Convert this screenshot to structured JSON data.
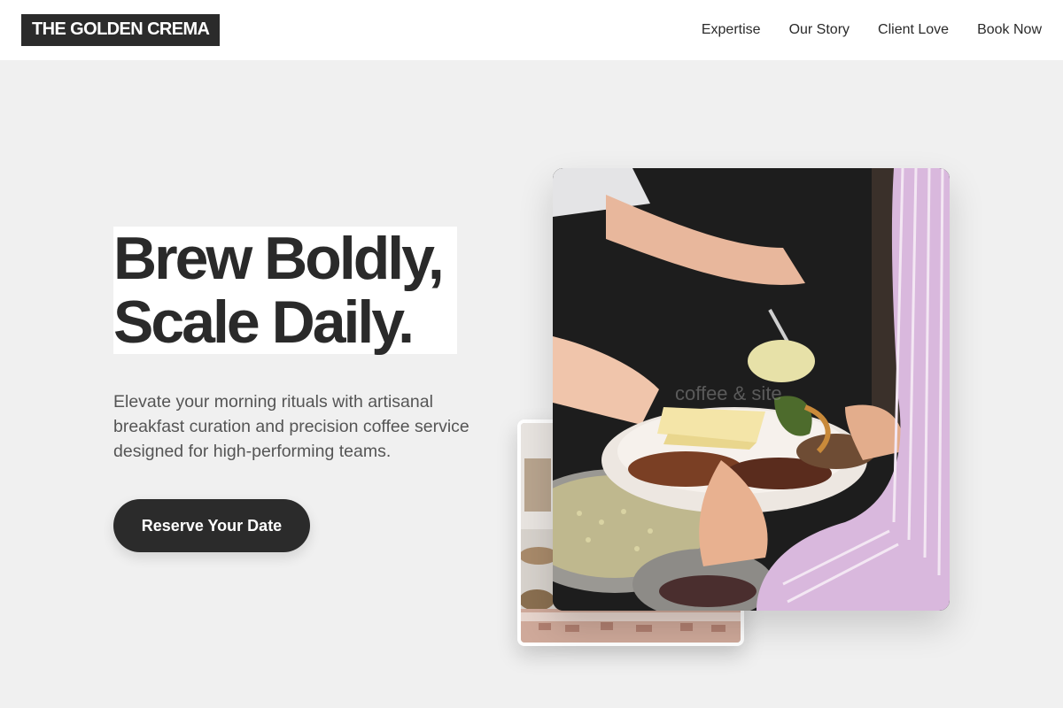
{
  "brand": {
    "logo_text": "THE GOLDEN CREMA"
  },
  "nav": {
    "items": [
      {
        "label": "Expertise"
      },
      {
        "label": "Our Story"
      },
      {
        "label": "Client Love"
      },
      {
        "label": "Book Now"
      }
    ]
  },
  "hero": {
    "title_line1": "Brew Boldly,",
    "title_line2": "Scale Daily.",
    "description": "Elevate your morning rituals with artisanal breakfast curation and precision coffee service designed for high-performing teams.",
    "cta_label": "Reserve Your Date",
    "main_photo_watermark": "coffee & site"
  },
  "colors": {
    "background": "#f0f0f0",
    "header": "#ffffff",
    "dark": "#2b2b2b",
    "body_text": "#555555"
  }
}
